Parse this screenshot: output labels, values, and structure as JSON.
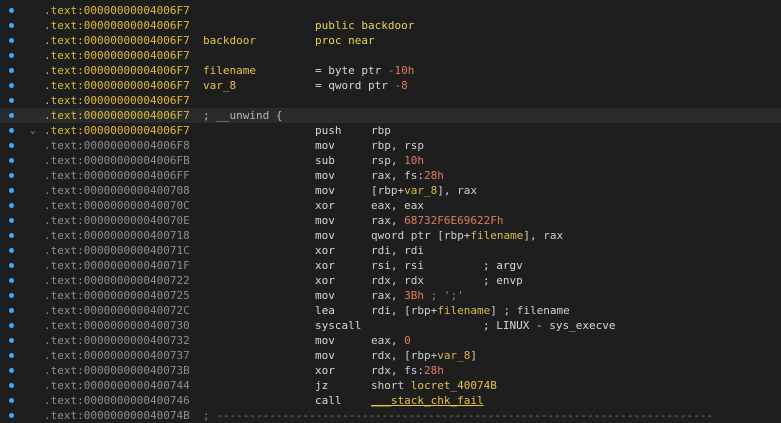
{
  "theme": {
    "background": "#1e1e1e",
    "breakpoint_dot": "#3fa9ff",
    "label_color": "#e8c04a",
    "constant_color": "#e07a5f"
  },
  "lines": [
    {
      "addr": ".text:00000000004006F7",
      "hi": true
    },
    {
      "addr": ".text:00000000004006F7",
      "hi": true,
      "rest": "public backdoor",
      "restClass": "c-kw"
    },
    {
      "addr": ".text:00000000004006F7",
      "hi": true,
      "label": "backdoor",
      "rest": "proc near",
      "restClass": "c-kw"
    },
    {
      "addr": ".text:00000000004006F7",
      "hi": true
    },
    {
      "addr": ".text:00000000004006F7",
      "hi": true,
      "label": "filename",
      "rest_parts": [
        [
          "= byte ptr ",
          "c-comment"
        ],
        [
          "-10h",
          "c-num"
        ]
      ]
    },
    {
      "addr": ".text:00000000004006F7",
      "hi": true,
      "label": "var_8",
      "rest_parts": [
        [
          "= qword ptr ",
          "c-comment"
        ],
        [
          "-8",
          "c-num"
        ]
      ]
    },
    {
      "addr": ".text:00000000004006F7",
      "hi": true
    },
    {
      "addr": ".text:00000000004006F7",
      "hi": true,
      "current": true,
      "label_grey": "; __unwind {"
    },
    {
      "addr": ".text:00000000004006F7",
      "hi": true,
      "arrow": true,
      "mn": "push",
      "op_parts": [
        [
          "rbp",
          "c-reg"
        ]
      ]
    },
    {
      "addr": ".text:00000000004006F8",
      "mn": "mov",
      "op_parts": [
        [
          "rbp, rsp",
          "c-reg"
        ]
      ]
    },
    {
      "addr": ".text:00000000004006FB",
      "mn": "sub",
      "op_parts": [
        [
          "rsp, ",
          "c-reg"
        ],
        [
          "10h",
          "c-num"
        ]
      ]
    },
    {
      "addr": ".text:00000000004006FF",
      "mn": "mov",
      "op_parts": [
        [
          "rax, fs:",
          "c-reg"
        ],
        [
          "28h",
          "c-num"
        ]
      ]
    },
    {
      "addr": ".text:0000000000400708",
      "mn": "mov",
      "op_parts": [
        [
          "[rbp+",
          "c-reg"
        ],
        [
          "var_8",
          "c-var"
        ],
        [
          "], rax",
          "c-reg"
        ]
      ]
    },
    {
      "addr": ".text:000000000040070C",
      "mn": "xor",
      "op_parts": [
        [
          "eax, eax",
          "c-reg"
        ]
      ]
    },
    {
      "addr": ".text:000000000040070E",
      "mn": "mov",
      "op_parts": [
        [
          "rax, ",
          "c-reg"
        ],
        [
          "68732F6E69622Fh",
          "c-num"
        ]
      ]
    },
    {
      "addr": ".text:0000000000400718",
      "mn": "mov",
      "op_parts": [
        [
          "qword ptr [rbp+",
          "c-reg"
        ],
        [
          "filename",
          "c-var"
        ],
        [
          "], rax",
          "c-reg"
        ]
      ]
    },
    {
      "addr": ".text:000000000040071C",
      "mn": "xor",
      "op_parts": [
        [
          "rdi, rdi",
          "c-reg"
        ]
      ]
    },
    {
      "addr": ".text:000000000040071F",
      "mn": "xor",
      "op_parts": [
        [
          "rsi, rsi",
          "c-reg"
        ]
      ],
      "comment": "; argv",
      "commentLeft": 483
    },
    {
      "addr": ".text:0000000000400722",
      "mn": "xor",
      "op_parts": [
        [
          "rdx, rdx",
          "c-reg"
        ]
      ],
      "comment": "; envp",
      "commentLeft": 483
    },
    {
      "addr": ".text:0000000000400725",
      "mn": "mov",
      "op_parts": [
        [
          "rax, ",
          "c-reg"
        ],
        [
          "3Bh",
          "c-num"
        ],
        [
          " ; ';'",
          "c-grey"
        ]
      ]
    },
    {
      "addr": ".text:000000000040072C",
      "mn": "lea",
      "op_parts": [
        [
          "rdi, [rbp+",
          "c-reg"
        ],
        [
          "filename",
          "c-var"
        ],
        [
          "] ; filename",
          "c-reg"
        ]
      ]
    },
    {
      "addr": ".text:0000000000400730",
      "mn": "syscall",
      "comment": "; LINUX - sys_execve",
      "commentLeft": 483
    },
    {
      "addr": ".text:0000000000400732",
      "mn": "mov",
      "op_parts": [
        [
          "eax, ",
          "c-reg"
        ],
        [
          "0",
          "c-num"
        ]
      ]
    },
    {
      "addr": ".text:0000000000400737",
      "mn": "mov",
      "op_parts": [
        [
          "rdx, [rbp+",
          "c-reg"
        ],
        [
          "var_8",
          "c-var"
        ],
        [
          "]",
          "c-reg"
        ]
      ]
    },
    {
      "addr": ".text:000000000040073B",
      "mn": "xor",
      "op_parts": [
        [
          "rdx, fs:",
          "c-reg"
        ],
        [
          "28h",
          "c-num"
        ]
      ]
    },
    {
      "addr": ".text:0000000000400744",
      "mn": "jz",
      "op_parts": [
        [
          "short ",
          "c-reg"
        ],
        [
          "locret_40074B",
          "c-func"
        ]
      ]
    },
    {
      "addr": ".text:0000000000400746",
      "mn": "call",
      "op_parts": [
        [
          "___stack_chk_fail",
          "c-func"
        ]
      ],
      "underline": true
    },
    {
      "addr": ".text:000000000040074B",
      "sep": "; ---------------------------------------------------------------------------"
    }
  ]
}
